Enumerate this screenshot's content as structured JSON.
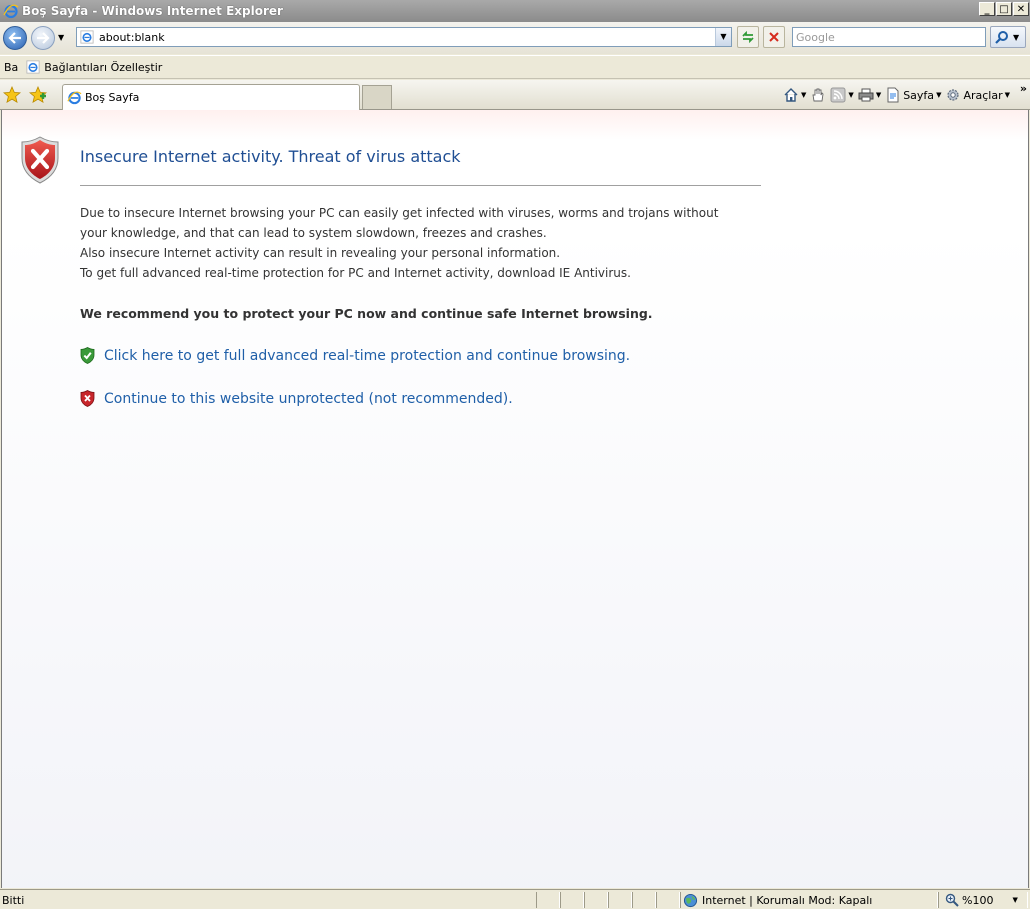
{
  "window": {
    "title": "Boş Sayfa - Windows Internet Explorer",
    "min_glyph": "_",
    "max_glyph": "□",
    "close_glyph": "✕"
  },
  "address_bar": {
    "url": "about:blank",
    "search_placeholder": "Google"
  },
  "links_bar": {
    "label": "Ba",
    "item": "Bağlantıları Özelleştir"
  },
  "tab": {
    "label": "Boş Sayfa"
  },
  "command_bar": {
    "page_label": "Sayfa",
    "tools_label": "Araçlar",
    "more": "»"
  },
  "page": {
    "title": "Insecure Internet activity. Threat of virus attack",
    "paragraph1": "Due to insecure Internet browsing your PC can easily get infected with viruses, worms and trojans without your knowledge, and that can lead to system slowdown, freezes and crashes.",
    "paragraph2": "Also insecure Internet activity can result in revealing your personal information.",
    "paragraph3": "To get full advanced real-time protection for PC and Internet activity, download IE Antivirus.",
    "recommendation": "We recommend you to protect your PC now and continue safe Internet browsing.",
    "protect_link": "Click here to get full advanced real-time protection and continue browsing.",
    "continue_link": "Continue to this website unprotected (not recommended)."
  },
  "status_bar": {
    "status": "Bitti",
    "zone": "Internet | Korumalı Mod: Kapalı",
    "zoom": "%100"
  },
  "colors": {
    "title_blue": "#1f4e93",
    "link_blue": "#1f5fa8",
    "shield_red": "#c8262b",
    "shield_green": "#3a9a3a"
  }
}
